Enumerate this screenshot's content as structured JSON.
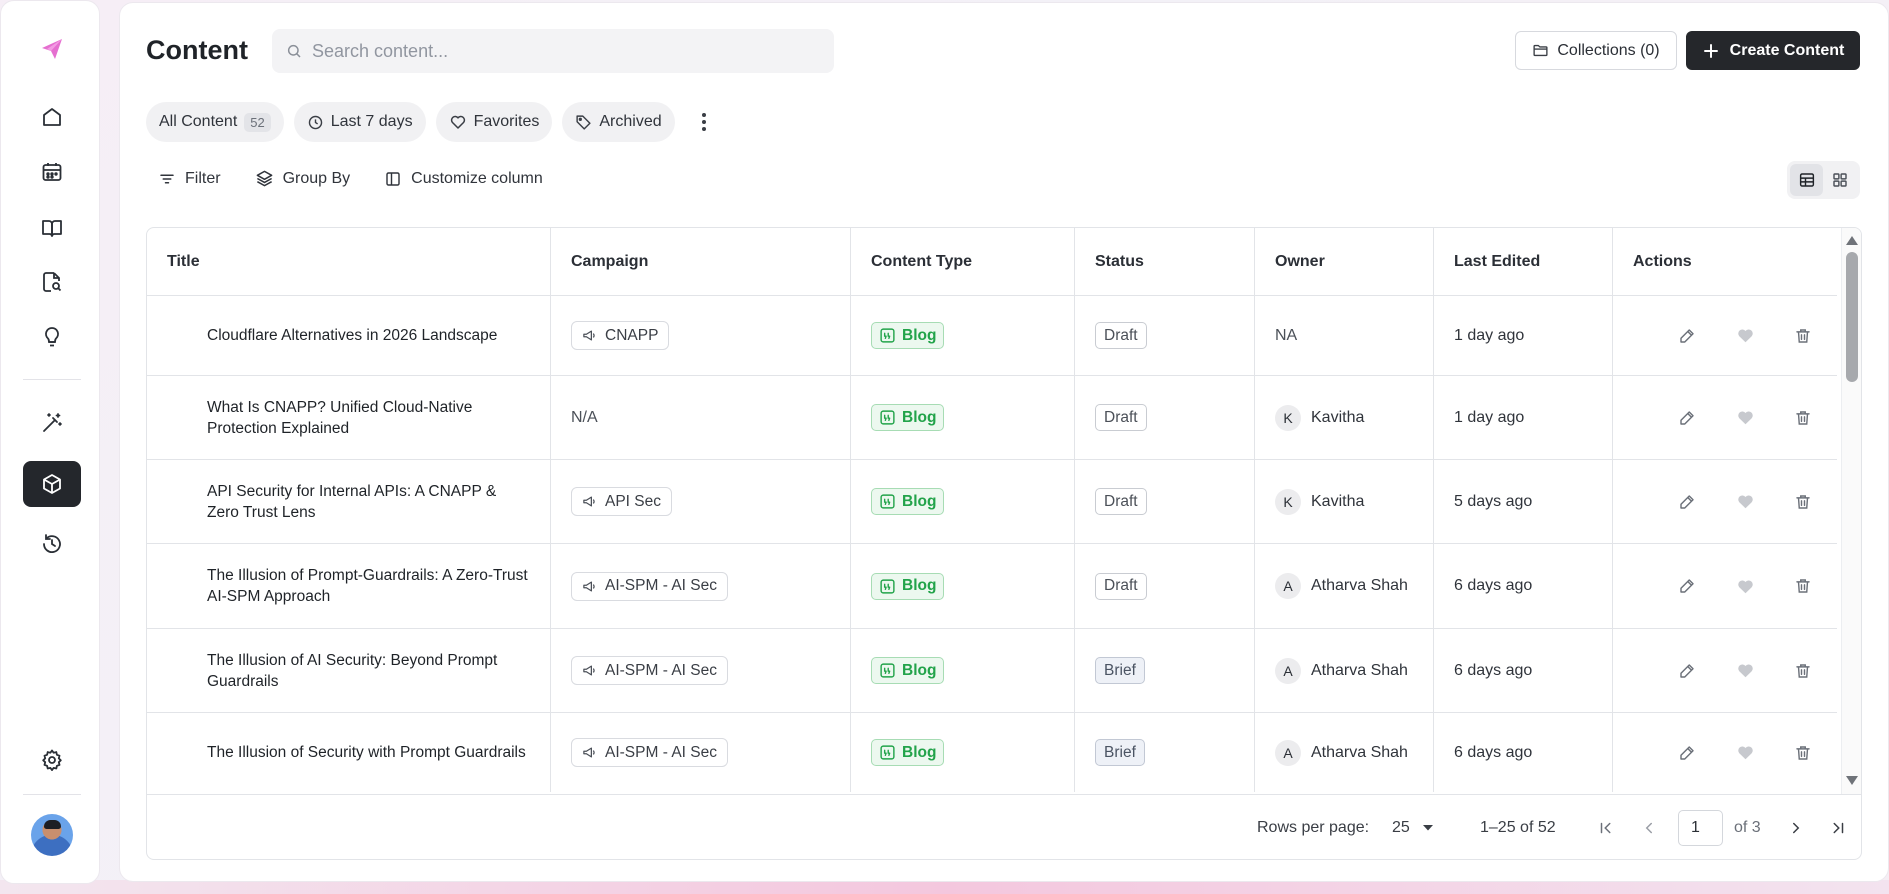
{
  "sidebar": {
    "items": [
      {
        "icon": "home-icon"
      },
      {
        "icon": "calendar-icon"
      },
      {
        "icon": "book-icon"
      },
      {
        "icon": "doc-search-icon"
      },
      {
        "icon": "lightbulb-icon"
      },
      {
        "icon": "magic-wand-icon"
      },
      {
        "icon": "box-icon",
        "active": true
      },
      {
        "icon": "history-icon"
      },
      {
        "icon": "gear-icon"
      }
    ]
  },
  "header": {
    "title": "Content",
    "search_placeholder": "Search content...",
    "collections_label": "Collections (0)",
    "create_label": "Create Content"
  },
  "chips": {
    "all_content": "All Content",
    "all_content_count": "52",
    "last7": "Last 7 days",
    "favorites": "Favorites",
    "archived": "Archived"
  },
  "toolbar": {
    "filter": "Filter",
    "group_by": "Group By",
    "customize": "Customize column"
  },
  "table": {
    "columns": [
      "Title",
      "Campaign",
      "Content Type",
      "Status",
      "Owner",
      "Last Edited",
      "Actions"
    ],
    "rows": [
      {
        "title": "Cloudflare Alternatives in 2026 Landscape",
        "campaign": "CNAPP",
        "type": "Blog",
        "status": "Draft",
        "owner": "NA",
        "owner_initial": "",
        "edited": "1 day ago"
      },
      {
        "title": "What Is CNAPP? Unified Cloud-Native Protection Explained",
        "campaign": "N/A",
        "type": "Blog",
        "status": "Draft",
        "owner": "Kavitha",
        "owner_initial": "K",
        "edited": "1 day ago"
      },
      {
        "title": "API Security for Internal APIs: A CNAPP & Zero Trust Lens",
        "campaign": "API Sec",
        "type": "Blog",
        "status": "Draft",
        "owner": "Kavitha",
        "owner_initial": "K",
        "edited": "5 days ago"
      },
      {
        "title": "The Illusion of Prompt-Guardrails: A Zero-Trust AI-SPM Approach",
        "campaign": "AI-SPM - AI Sec",
        "type": "Blog",
        "status": "Draft",
        "owner": "Atharva Shah",
        "owner_initial": "A",
        "edited": "6 days ago"
      },
      {
        "title": "The Illusion of AI Security: Beyond Prompt Guardrails",
        "campaign": "AI-SPM - AI Sec",
        "type": "Blog",
        "status": "Brief",
        "owner": "Atharva Shah",
        "owner_initial": "A",
        "edited": "6 days ago"
      },
      {
        "title": "The Illusion of Security with Prompt Guardrails",
        "campaign": "AI-SPM - AI Sec",
        "type": "Blog",
        "status": "Brief",
        "owner": "Atharva Shah",
        "owner_initial": "A",
        "edited": "6 days ago"
      }
    ]
  },
  "pagination": {
    "rows_per_page_label": "Rows per page:",
    "rows_per_page": "25",
    "range": "1–25 of 52",
    "page": "1",
    "of_pages": "of 3"
  }
}
